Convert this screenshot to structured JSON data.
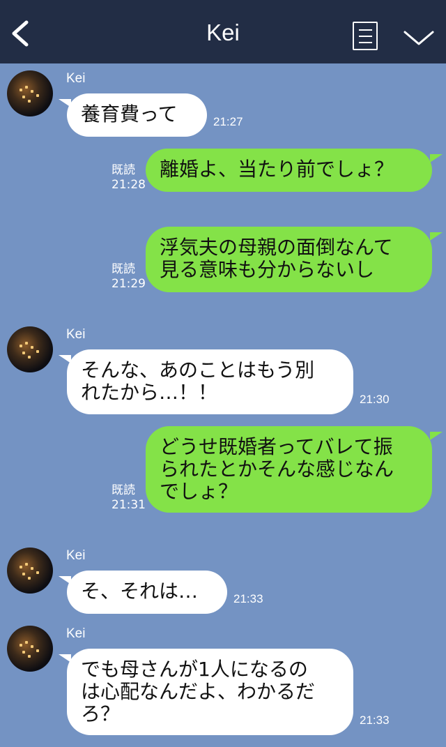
{
  "header": {
    "title": "Kei",
    "icons": [
      "chevron-left-icon",
      "note-icon",
      "chevron-down-icon"
    ]
  },
  "messages": [
    {
      "side": "left",
      "sender": "Kei",
      "text": "養育費って",
      "time": "21:27"
    },
    {
      "side": "right",
      "read": "既読",
      "text": "離婚よ、当たり前でしょ？",
      "time": "21:28"
    },
    {
      "side": "right",
      "read": "既読",
      "lines": [
        "浮気夫の母親の面倒なんて",
        "見る意味も分からないし"
      ],
      "time": "21:29"
    },
    {
      "side": "left",
      "sender": "Kei",
      "lines": [
        "そんな、あのことはもう別",
        "れたから…！！"
      ],
      "time": "21:30"
    },
    {
      "side": "right",
      "read": "既読",
      "lines": [
        "どうせ既婚者ってバレて振",
        "られたとかそんな感じなん",
        "でしょ？"
      ],
      "time": "21:31"
    },
    {
      "side": "left",
      "sender": "Kei",
      "text": "そ、それは…",
      "time": "21:33"
    },
    {
      "side": "left",
      "sender": "Kei",
      "lines": [
        "でも母さんが1人になるの",
        "は心配なんだよ、わかるだ",
        "ろ？"
      ],
      "time": "21:33"
    }
  ],
  "colors": {
    "header_bg": "#222d45",
    "chat_bg": "#7493c3",
    "bubble_sent": "#84e248",
    "bubble_received": "#ffffff"
  }
}
